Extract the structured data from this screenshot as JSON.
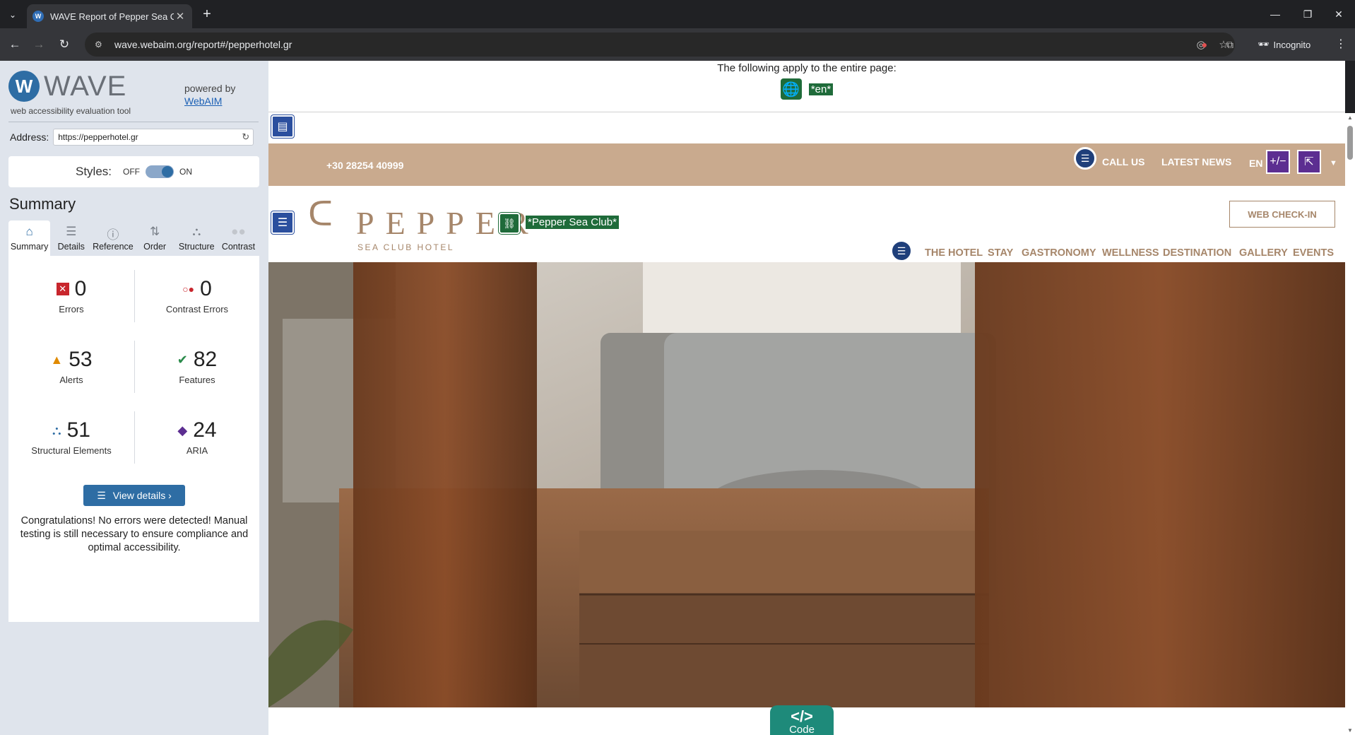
{
  "browser": {
    "tab_title": "WAVE Report of Pepper Sea Clu",
    "url": "wave.webaim.org/report#/pepperhotel.gr",
    "incognito_label": "Incognito",
    "extension_badge": "1"
  },
  "wave": {
    "logo_text": "WAVE",
    "tagline": "web accessibility evaluation tool",
    "powered_by": "powered by",
    "webaim_link": "WebAIM",
    "address_label": "Address:",
    "address_value": "https://pepperhotel.gr",
    "styles_label": "Styles:",
    "styles_off": "OFF",
    "styles_on": "ON",
    "summary_heading": "Summary",
    "tabs": [
      {
        "label": "Summary",
        "icon": "home-icon"
      },
      {
        "label": "Details",
        "icon": "list-icon"
      },
      {
        "label": "Reference",
        "icon": "info-icon"
      },
      {
        "label": "Order",
        "icon": "order-icon"
      },
      {
        "label": "Structure",
        "icon": "structure-icon"
      },
      {
        "label": "Contrast",
        "icon": "contrast-icon"
      }
    ],
    "stats": {
      "errors": {
        "value": "0",
        "label": "Errors"
      },
      "contrast_errors": {
        "value": "0",
        "label": "Contrast Errors"
      },
      "alerts": {
        "value": "53",
        "label": "Alerts"
      },
      "features": {
        "value": "82",
        "label": "Features"
      },
      "structural": {
        "value": "51",
        "label": "Structural Elements"
      },
      "aria": {
        "value": "24",
        "label": "ARIA"
      }
    },
    "view_details": "View details ›",
    "congrats": "Congratulations! No errors were detected! Manual testing is still necessary to ensure compliance and optimal accessibility."
  },
  "site": {
    "apply_text": "The following apply to the entire page:",
    "lang_tag": "*en*",
    "phone": "+30 28254 40999",
    "call_us": "CALL US",
    "latest_news": "LATEST NEWS",
    "lang": "EN",
    "brand_name": "PEPPER",
    "brand_sub": "SEA CLUB HOTEL",
    "alt_tag": "*Pepper Sea Club*",
    "web_checkin": "WEB CHECK-IN",
    "nav": [
      "THE HOTEL",
      "STAY",
      "GASTRONOMY",
      "WELLNESS",
      "DESTINATION",
      "GALLERY",
      "EVENTS"
    ],
    "code_label": "Code",
    "code_symbol": "</>"
  },
  "colors": {
    "wave_blue": "#2e6da4",
    "feature_green": "#1f6b3a",
    "aria_purple": "#5c2e91",
    "brand_tan": "#a6866a",
    "topbar_tan": "#c9aa8e"
  }
}
